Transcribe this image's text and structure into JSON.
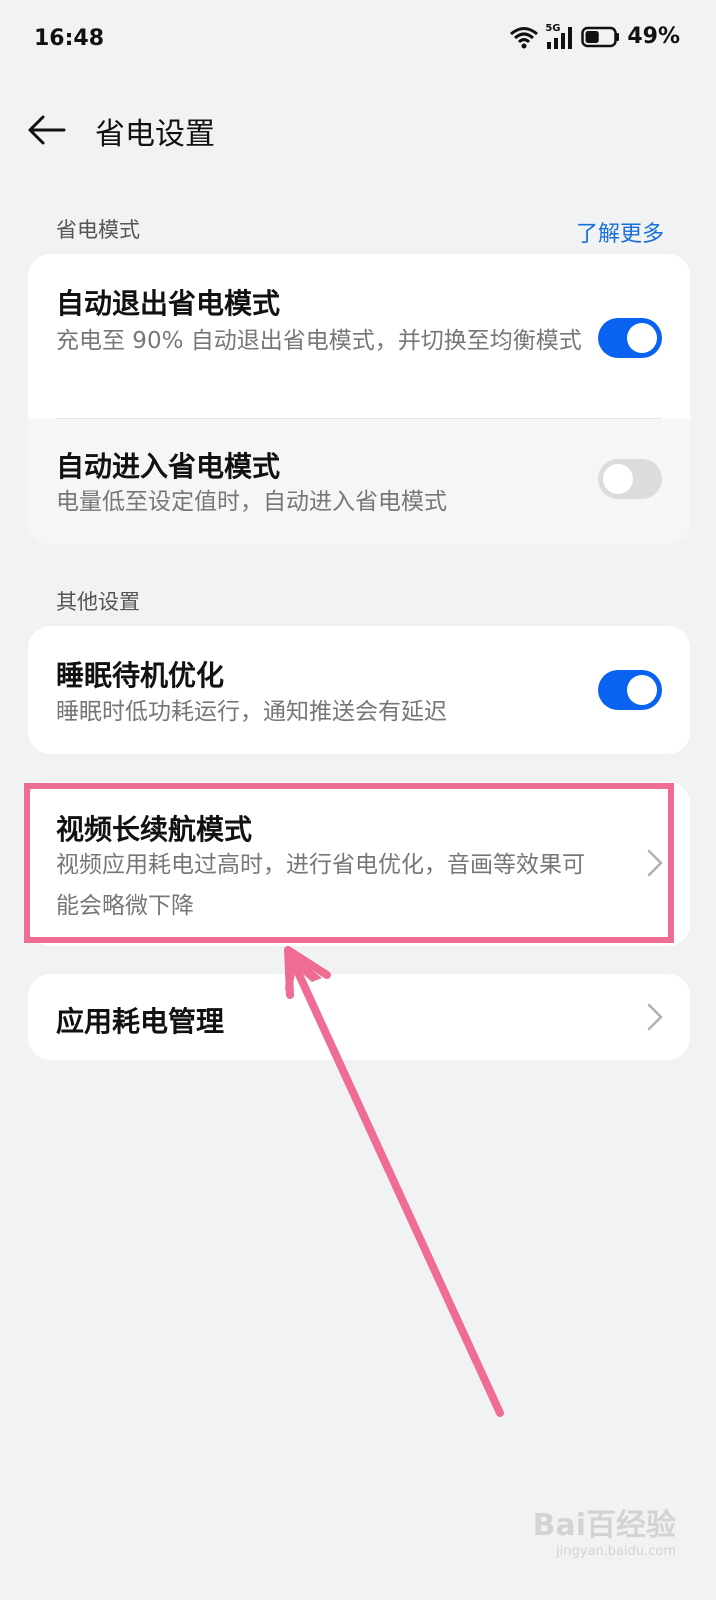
{
  "status_bar": {
    "time": "16:48",
    "network_badge": "5G",
    "battery_percent": "49%",
    "battery_level": 0.49
  },
  "header": {
    "title": "省电设置"
  },
  "sections": {
    "power_mode": {
      "label": "省电模式",
      "link": "了解更多",
      "items": [
        {
          "title": "自动退出省电模式",
          "desc": "充电至 90% 自动退出省电模式，并切换至均衡模式",
          "toggle": true
        },
        {
          "title": "自动进入省电模式",
          "desc": "电量低至设定值时，自动进入省电模式",
          "toggle": false
        }
      ]
    },
    "other": {
      "label": "其他设置",
      "items": [
        {
          "title": "睡眠待机优化",
          "desc": "睡眠时低功耗运行，通知推送会有延迟",
          "toggle": true
        },
        {
          "title": "视频长续航模式",
          "desc": "视频应用耗电过高时，进行省电优化，音画等效果可能会略微下降"
        }
      ]
    },
    "app_power": {
      "title": "应用耗电管理"
    }
  },
  "annotation": {
    "highlight_color": "#ef6d93"
  },
  "watermark": {
    "logo": "Bai百经验",
    "sub": "jingyan.baidu.com"
  },
  "colors": {
    "accent": "#0a63f0",
    "link": "#1a6fd6",
    "background": "#f1f2f4"
  }
}
